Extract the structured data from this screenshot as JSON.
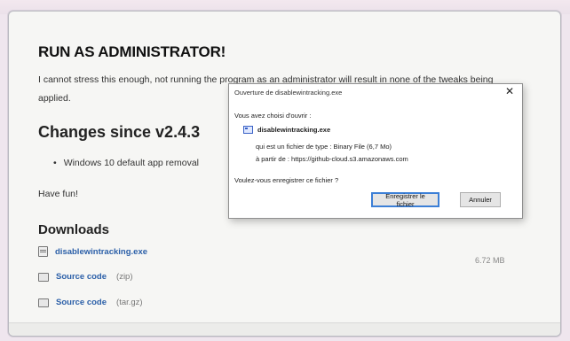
{
  "page": {
    "heading_admin": "RUN AS ADMINISTRATOR!",
    "warning_text": "I cannot stress this enough, not running the program as an administrator will result in none of the tweaks being applied.",
    "heading_changes": "Changes since v2.4.3",
    "changes": [
      "Windows 10 default app removal"
    ],
    "have_fun": "Have fun!",
    "heading_downloads": "Downloads",
    "downloads": [
      {
        "label": "disablewintracking.exe",
        "suffix": "",
        "size": "6.72 MB",
        "icon": "file-icon"
      },
      {
        "label": "Source code",
        "suffix": "(zip)",
        "icon": "package-icon"
      },
      {
        "label": "Source code",
        "suffix": "(tar.gz)",
        "icon": "package-icon"
      }
    ]
  },
  "dialog": {
    "title": "Ouverture de disablewintracking.exe",
    "close": "✕",
    "prompt": "Vous avez choisi d'ouvrir :",
    "filename": "disablewintracking.exe",
    "type_line": "qui est un fichier de type : Binary File (6,7 Mo)",
    "from_line": "à partir de : https://github-cloud.s3.amazonaws.com",
    "question": "Voulez-vous enregistrer ce fichier ?",
    "save_label": "Enregistrer le fichier",
    "cancel_label": "Annuler"
  },
  "colors": {
    "link": "#2b5fa8",
    "accent": "#3c7fd6"
  }
}
